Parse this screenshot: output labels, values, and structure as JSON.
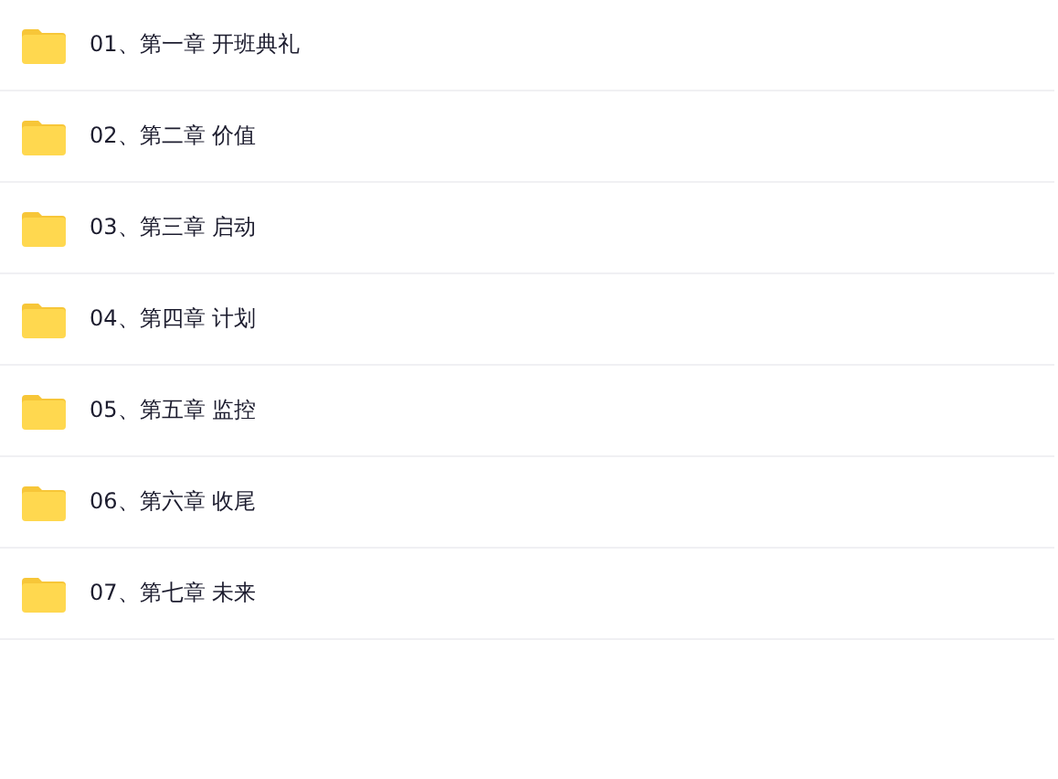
{
  "folders": [
    {
      "name": "01、第一章 开班典礼"
    },
    {
      "name": "02、第二章 价值"
    },
    {
      "name": "03、第三章 启动"
    },
    {
      "name": "04、第四章 计划"
    },
    {
      "name": "05、第五章 监控"
    },
    {
      "name": "06、第六章 收尾"
    },
    {
      "name": "07、第七章 未来"
    }
  ]
}
